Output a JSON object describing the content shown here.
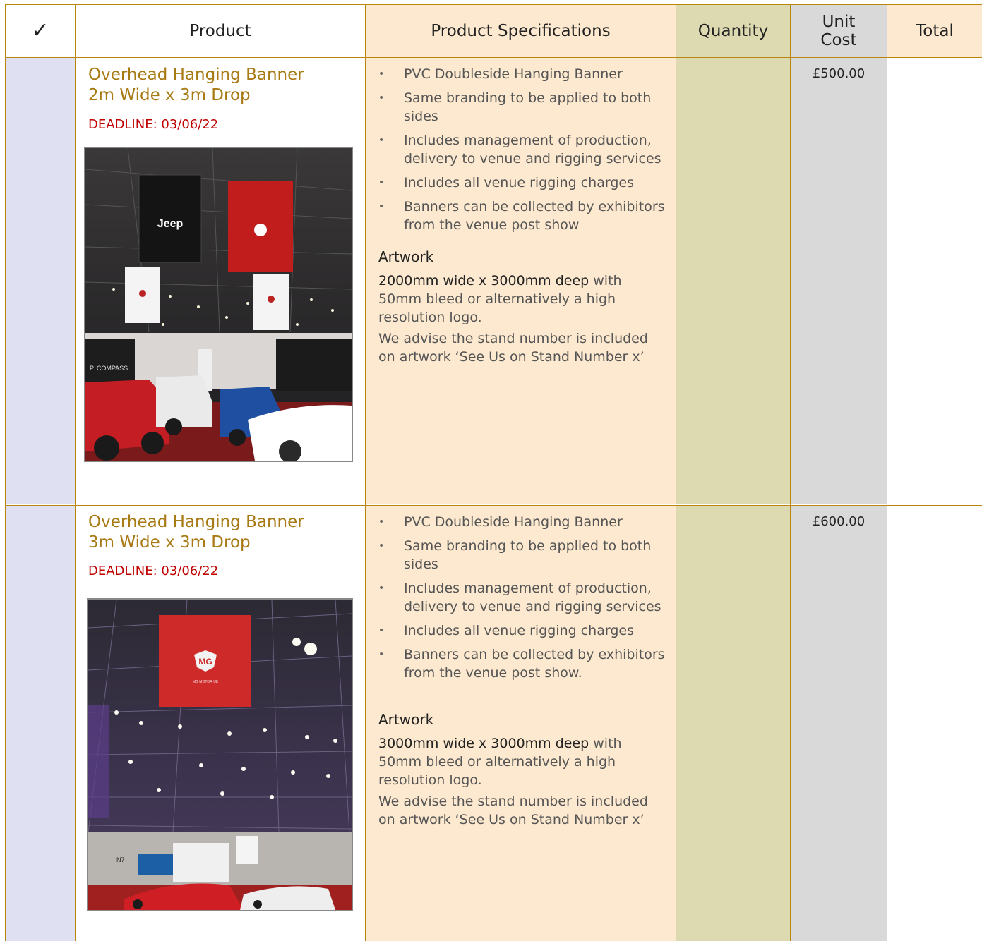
{
  "header": {
    "check": "✓",
    "product": "Product",
    "specifications": "Product Specifications",
    "quantity": "Quantity",
    "unit_cost_line1": "Unit",
    "unit_cost_line2": "Cost",
    "total": "Total"
  },
  "rows": [
    {
      "title_line1": "Overhead Hanging Banner",
      "title_line2": "2m Wide x 3m Drop",
      "deadline": "DEADLINE: 03/06/22",
      "bullets": [
        "PVC Doubleside Hanging Banner",
        "Same branding to be applied to both sides",
        "Includes management of production, delivery to venue and rigging services",
        "Includes all venue rigging charges",
        "Banners can be collected by exhibitors from the venue post show"
      ],
      "artwork_title": "Artwork",
      "artwork_dimensions": "2000mm wide x 3000mm deep",
      "artwork_rest": " with 50mm bleed or alternatively a high resolution logo.",
      "advice": "We advise the stand number is included on artwork ‘See Us on Stand Number x’",
      "unit_cost": "£500.00",
      "photo_banner_1": "Jeep"
    },
    {
      "title_line1": "Overhead Hanging Banner",
      "title_line2": "3m Wide x 3m Drop",
      "deadline": "DEADLINE: 03/06/22",
      "bullets": [
        "PVC Doubleside Hanging Banner",
        "Same branding to be applied to both sides",
        "Includes management of production, delivery to venue and rigging services",
        "Includes all venue rigging charges",
        "Banners can be collected by exhibitors from the venue post show."
      ],
      "artwork_title": "Artwork",
      "artwork_dimensions": "3000mm wide x 3000mm deep",
      "artwork_rest": " with 50mm bleed or alternatively a high resolution logo.",
      "advice": "We advise the stand number is included on artwork ‘See Us on Stand Number x’",
      "unit_cost": "£600.00",
      "photo_banner_1": "MG",
      "photo_banner_2": "MG MOTOR UK"
    }
  ]
}
